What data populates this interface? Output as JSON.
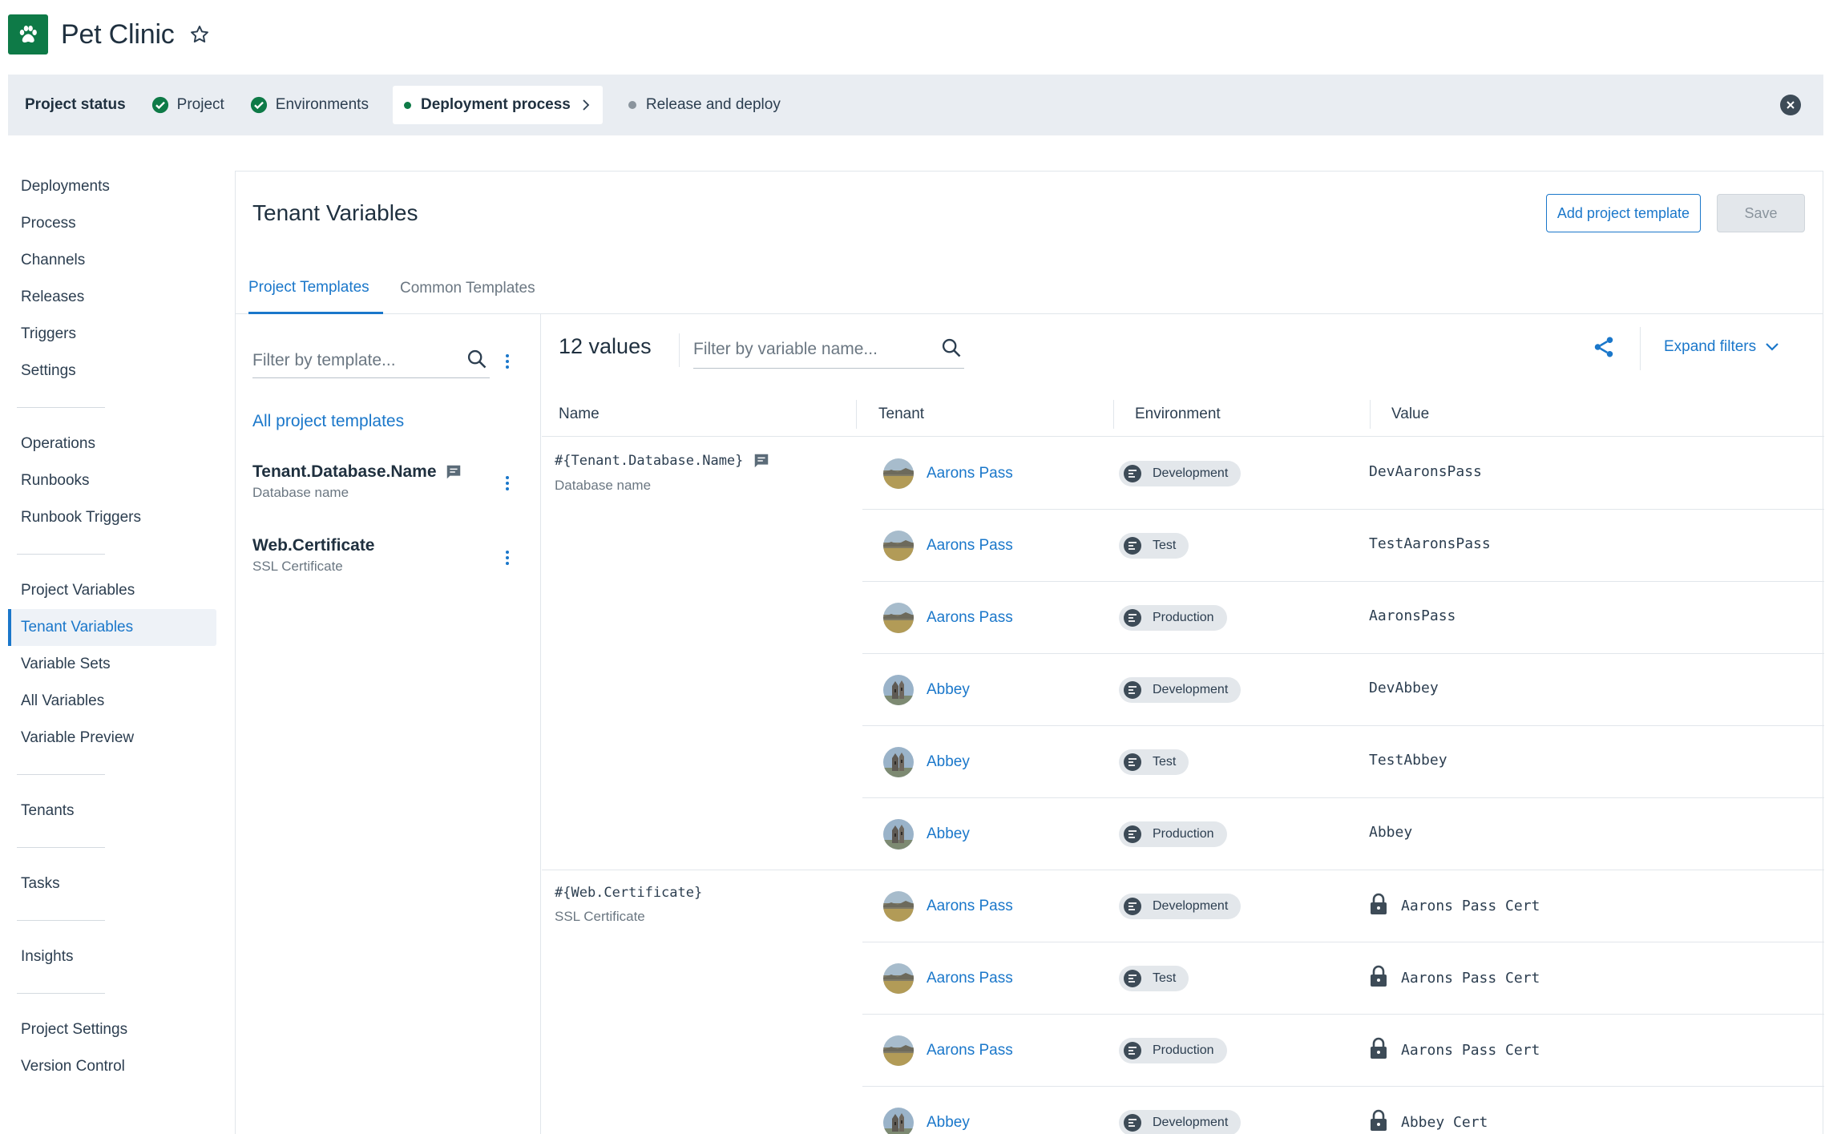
{
  "app": {
    "title": "Pet Clinic",
    "logo_icon": "paw-icon"
  },
  "status": {
    "label": "Project status",
    "steps": [
      {
        "label": "Project",
        "state": "done"
      },
      {
        "label": "Environments",
        "state": "done"
      },
      {
        "label": "Deployment process",
        "state": "current"
      },
      {
        "label": "Release and deploy",
        "state": "pending"
      }
    ]
  },
  "sidebar": {
    "groups": [
      [
        "Deployments",
        "Process",
        "Channels",
        "Releases",
        "Triggers",
        "Settings"
      ],
      [
        "Operations",
        "Runbooks",
        "Runbook Triggers"
      ],
      [
        "Project Variables",
        "Tenant Variables",
        "Variable Sets",
        "All Variables",
        "Variable Preview"
      ],
      [
        "Tenants"
      ],
      [
        "Tasks"
      ],
      [
        "Insights"
      ],
      [
        "Project Settings",
        "Version Control"
      ]
    ],
    "active": "Tenant Variables"
  },
  "page": {
    "title": "Tenant Variables",
    "add_button": "Add project template",
    "save_button": "Save",
    "tabs": [
      {
        "label": "Project Templates",
        "active": true
      },
      {
        "label": "Common Templates",
        "active": false
      }
    ]
  },
  "templates": {
    "filter_placeholder": "Filter by template...",
    "all_label": "All project templates",
    "items": [
      {
        "name": "Tenant.Database.Name",
        "desc": "Database name",
        "has_comment": true
      },
      {
        "name": "Web.Certificate",
        "desc": "SSL Certificate",
        "has_comment": false
      }
    ]
  },
  "values": {
    "count": "12 values",
    "filter_placeholder": "Filter by variable name...",
    "expand_label": "Expand filters",
    "columns": [
      "Name",
      "Tenant",
      "Environment",
      "Value"
    ],
    "groups": [
      {
        "var": "#{Tenant.Database.Name}",
        "desc": "Database name",
        "has_comment": true,
        "rows": [
          {
            "tenant": "Aarons Pass",
            "env": "Development",
            "value": "DevAaronsPass",
            "sensitive": false
          },
          {
            "tenant": "Aarons Pass",
            "env": "Test",
            "value": "TestAaronsPass",
            "sensitive": false
          },
          {
            "tenant": "Aarons Pass",
            "env": "Production",
            "value": "AaronsPass",
            "sensitive": false
          },
          {
            "tenant": "Abbey",
            "env": "Development",
            "value": "DevAbbey",
            "sensitive": false
          },
          {
            "tenant": "Abbey",
            "env": "Test",
            "value": "TestAbbey",
            "sensitive": false
          },
          {
            "tenant": "Abbey",
            "env": "Production",
            "value": "Abbey",
            "sensitive": false
          }
        ]
      },
      {
        "var": "#{Web.Certificate}",
        "desc": "SSL Certificate",
        "has_comment": false,
        "rows": [
          {
            "tenant": "Aarons Pass",
            "env": "Development",
            "value": "Aarons Pass Cert",
            "sensitive": true
          },
          {
            "tenant": "Aarons Pass",
            "env": "Test",
            "value": "Aarons Pass Cert",
            "sensitive": true
          },
          {
            "tenant": "Aarons Pass",
            "env": "Production",
            "value": "Aarons Pass Cert",
            "sensitive": true
          },
          {
            "tenant": "Abbey",
            "env": "Development",
            "value": "Abbey Cert",
            "sensitive": true
          }
        ]
      }
    ]
  },
  "colors": {
    "accent": "#1a77ca",
    "brand": "#0e7a47",
    "text": "#1f303f",
    "muted": "#6b7782"
  }
}
